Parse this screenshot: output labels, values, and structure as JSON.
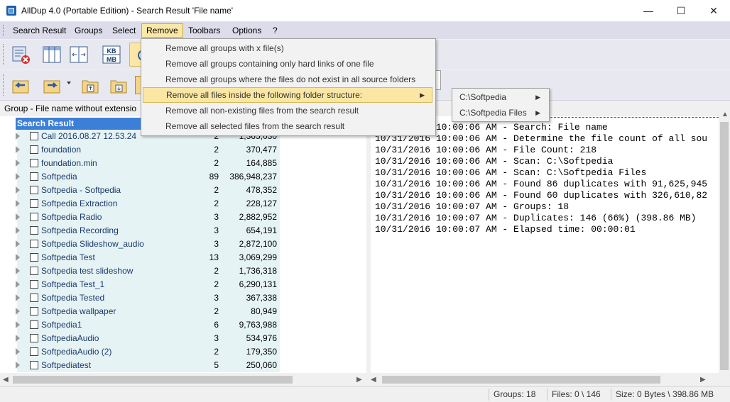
{
  "window": {
    "title": "AllDup 4.0 (Portable Edition) - Search Result 'File name'",
    "minimize": "—",
    "maximize": "☐",
    "close": "✕"
  },
  "menu": {
    "items": [
      "Search Result",
      "Groups",
      "Select",
      "Remove",
      "Toolbars",
      "Options",
      "?"
    ]
  },
  "toolbar": {
    "kb_label": "KB",
    "mb_label": "MB"
  },
  "tree": {
    "group_header": "Group - File name without extensio",
    "root_label": "Search Result",
    "rows": [
      {
        "name": "Call 2016.08.27 12.53.24",
        "count": "2",
        "size": "1,365,030"
      },
      {
        "name": "foundation",
        "count": "2",
        "size": "370,477"
      },
      {
        "name": "foundation.min",
        "count": "2",
        "size": "164,885"
      },
      {
        "name": "Softpedia",
        "count": "89",
        "size": "386,948,237"
      },
      {
        "name": "Softpedia - Softpedia",
        "count": "2",
        "size": "478,352"
      },
      {
        "name": "Softpedia Extraction",
        "count": "2",
        "size": "228,127"
      },
      {
        "name": "Softpedia Radio",
        "count": "3",
        "size": "2,882,952"
      },
      {
        "name": "Softpedia Recording",
        "count": "3",
        "size": "654,191"
      },
      {
        "name": "Softpedia Slideshow_audio",
        "count": "3",
        "size": "2,872,100"
      },
      {
        "name": "Softpedia Test",
        "count": "13",
        "size": "3,069,299"
      },
      {
        "name": "Softpedia test slideshow",
        "count": "2",
        "size": "1,736,318"
      },
      {
        "name": "Softpedia Test_1",
        "count": "2",
        "size": "6,290,131"
      },
      {
        "name": "Softpedia Tested",
        "count": "3",
        "size": "367,338"
      },
      {
        "name": "Softpedia wallpaper",
        "count": "2",
        "size": "80,949"
      },
      {
        "name": "Softpedia1",
        "count": "6",
        "size": "9,763,988"
      },
      {
        "name": "SoftpediaAudio",
        "count": "3",
        "size": "534,976"
      },
      {
        "name": "SoftpediaAudio (2)",
        "count": "2",
        "size": "179,350"
      },
      {
        "name": "Softpediatest",
        "count": "5",
        "size": "250,060"
      }
    ]
  },
  "log": {
    "lines": [
      "10/31/2016 10:00:06 AM - Search: File name",
      "10/31/2016 10:00:06 AM - Determine the file count of all sou",
      "10/31/2016 10:00:06 AM - File Count: 218",
      "10/31/2016 10:00:06 AM - Scan: C:\\Softpedia",
      "10/31/2016 10:00:06 AM - Scan: C:\\Softpedia Files",
      "10/31/2016 10:00:06 AM - Found 86 duplicates with 91,625,945",
      "10/31/2016 10:00:06 AM - Found 60 duplicates with 326,610,82",
      "10/31/2016 10:00:07 AM - Groups: 18",
      "10/31/2016 10:00:07 AM - Duplicates: 146 (66%) (398.86 MB)",
      "10/31/2016 10:00:07 AM - Elapsed time: 00:00:01"
    ]
  },
  "remove_menu": {
    "items": [
      "Remove all groups with x file(s)",
      "Remove all groups containing only hard links of one file",
      "Remove all groups where the files do not exist in all source folders",
      "Remove all files inside the following folder structure:",
      "Remove all non-existing files from the search result",
      "Remove all selected files from the search result"
    ]
  },
  "sub_menu": {
    "items": [
      "C:\\Softpedia",
      "C:\\Softpedia Files"
    ]
  },
  "status": {
    "groups": "Groups: 18",
    "files": "Files: 0 \\ 146",
    "size": "Size: 0 Bytes \\ 398.86 MB"
  },
  "colors": {
    "accent": "#3c7fd8",
    "menu_highlight": "#fbe7a3",
    "row_background": "#e6f3f5"
  }
}
